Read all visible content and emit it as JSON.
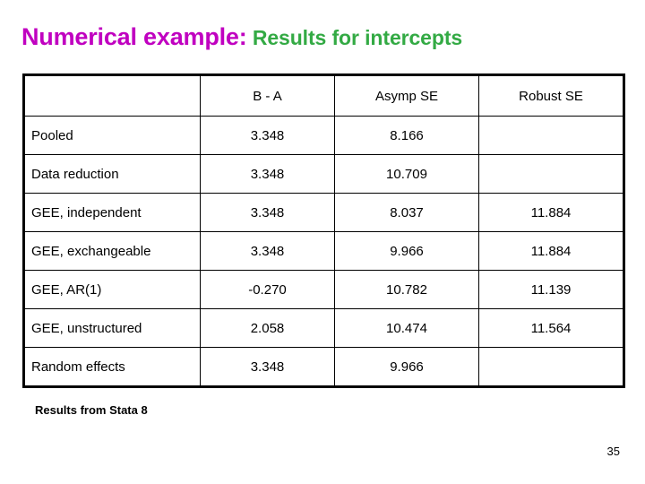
{
  "slide": {
    "title_lead": "Numerical example:",
    "title_rest": " Results for intercepts",
    "title_lead_color": "#c000c0",
    "title_rest_color": "#33aa44",
    "footer_note": "Results from Stata 8",
    "page_number": "35"
  },
  "chart_data": {
    "type": "table",
    "title": "Numerical example: Results for intercepts",
    "columns": [
      "",
      "B - A",
      "Asymp SE",
      "Robust SE"
    ],
    "rows": [
      {
        "label": "Pooled",
        "b_minus_a": "3.348",
        "asymp_se": "8.166",
        "robust_se": ""
      },
      {
        "label": "Data reduction",
        "b_minus_a": "3.348",
        "asymp_se": "10.709",
        "robust_se": ""
      },
      {
        "label": "GEE, independent",
        "b_minus_a": "3.348",
        "asymp_se": "8.037",
        "robust_se": "11.884"
      },
      {
        "label": "GEE, exchangeable",
        "b_minus_a": "3.348",
        "asymp_se": "9.966",
        "robust_se": "11.884"
      },
      {
        "label": "GEE, AR(1)",
        "b_minus_a": "-0.270",
        "asymp_se": "10.782",
        "robust_se": "11.139"
      },
      {
        "label": "GEE, unstructured",
        "b_minus_a": "2.058",
        "asymp_se": "10.474",
        "robust_se": "11.564"
      },
      {
        "label": "Random effects",
        "b_minus_a": "3.348",
        "asymp_se": "9.966",
        "robust_se": ""
      }
    ],
    "note": "Results from Stata 8"
  }
}
